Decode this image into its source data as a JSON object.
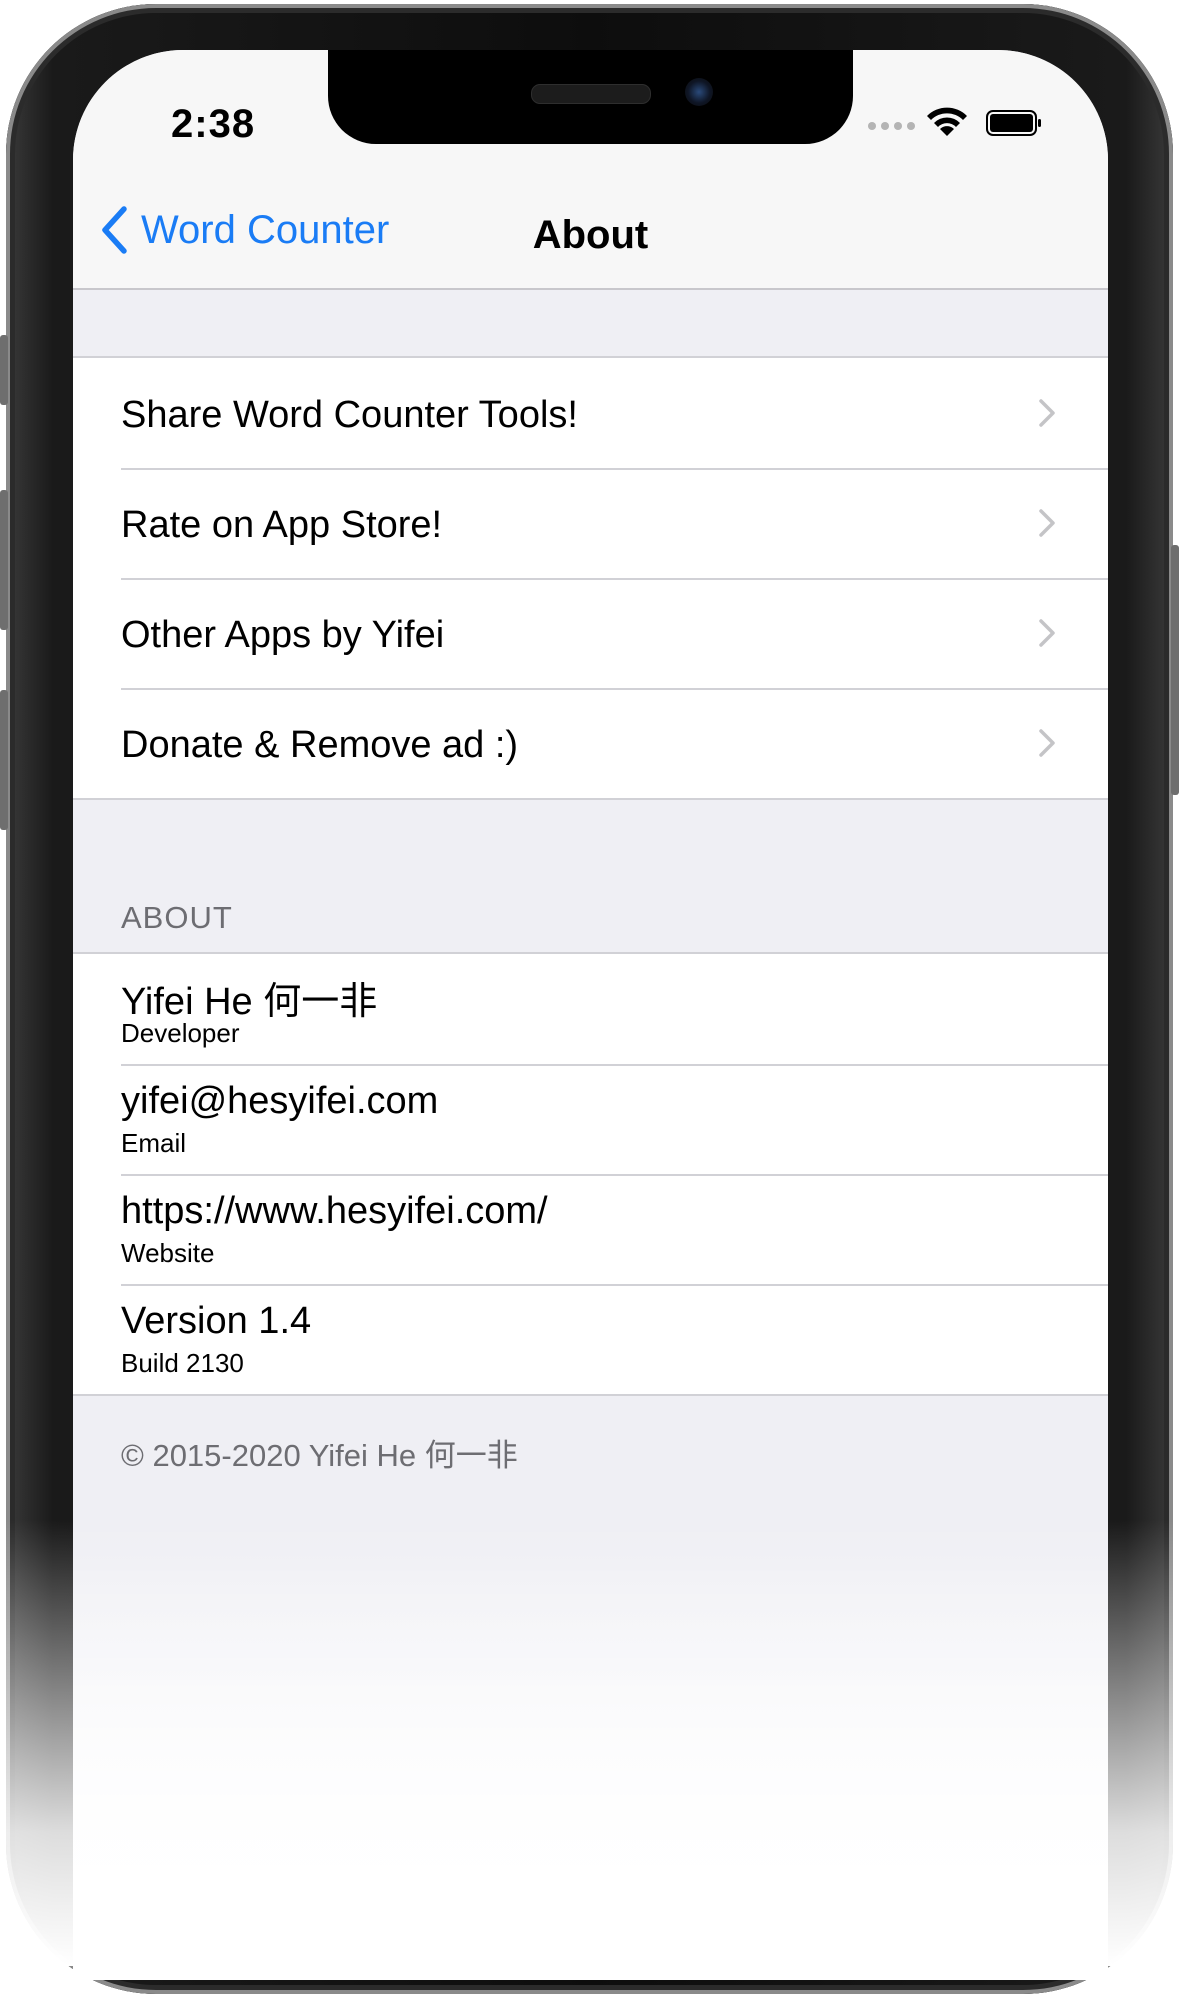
{
  "status_bar": {
    "time": "2:38"
  },
  "nav": {
    "back_label": "Word Counter",
    "title": "About"
  },
  "actions": [
    {
      "label": "Share Word Counter Tools!"
    },
    {
      "label": "Rate on App Store!"
    },
    {
      "label": "Other Apps by Yifei"
    },
    {
      "label": "Donate & Remove ad :)"
    }
  ],
  "about": {
    "header": "ABOUT",
    "items": [
      {
        "title": "Yifei He 何一非",
        "subtitle": "Developer"
      },
      {
        "title": "yifei@hesyifei.com",
        "subtitle": "Email"
      },
      {
        "title": "https://www.hesyifei.com/",
        "subtitle": "Website"
      },
      {
        "title": "Version 1.4",
        "subtitle": "Build 2130"
      }
    ],
    "footer": "© 2015-2020 Yifei He 何一非"
  },
  "colors": {
    "accent": "#1a7cf5",
    "background": "#efeff4",
    "separator": "#d1d1d6",
    "secondary_text": "#6d6d72"
  },
  "icons": [
    "back-chevron-icon",
    "disclosure-chevron-icon",
    "wifi-icon",
    "battery-icon",
    "cellular-signal-icon"
  ]
}
